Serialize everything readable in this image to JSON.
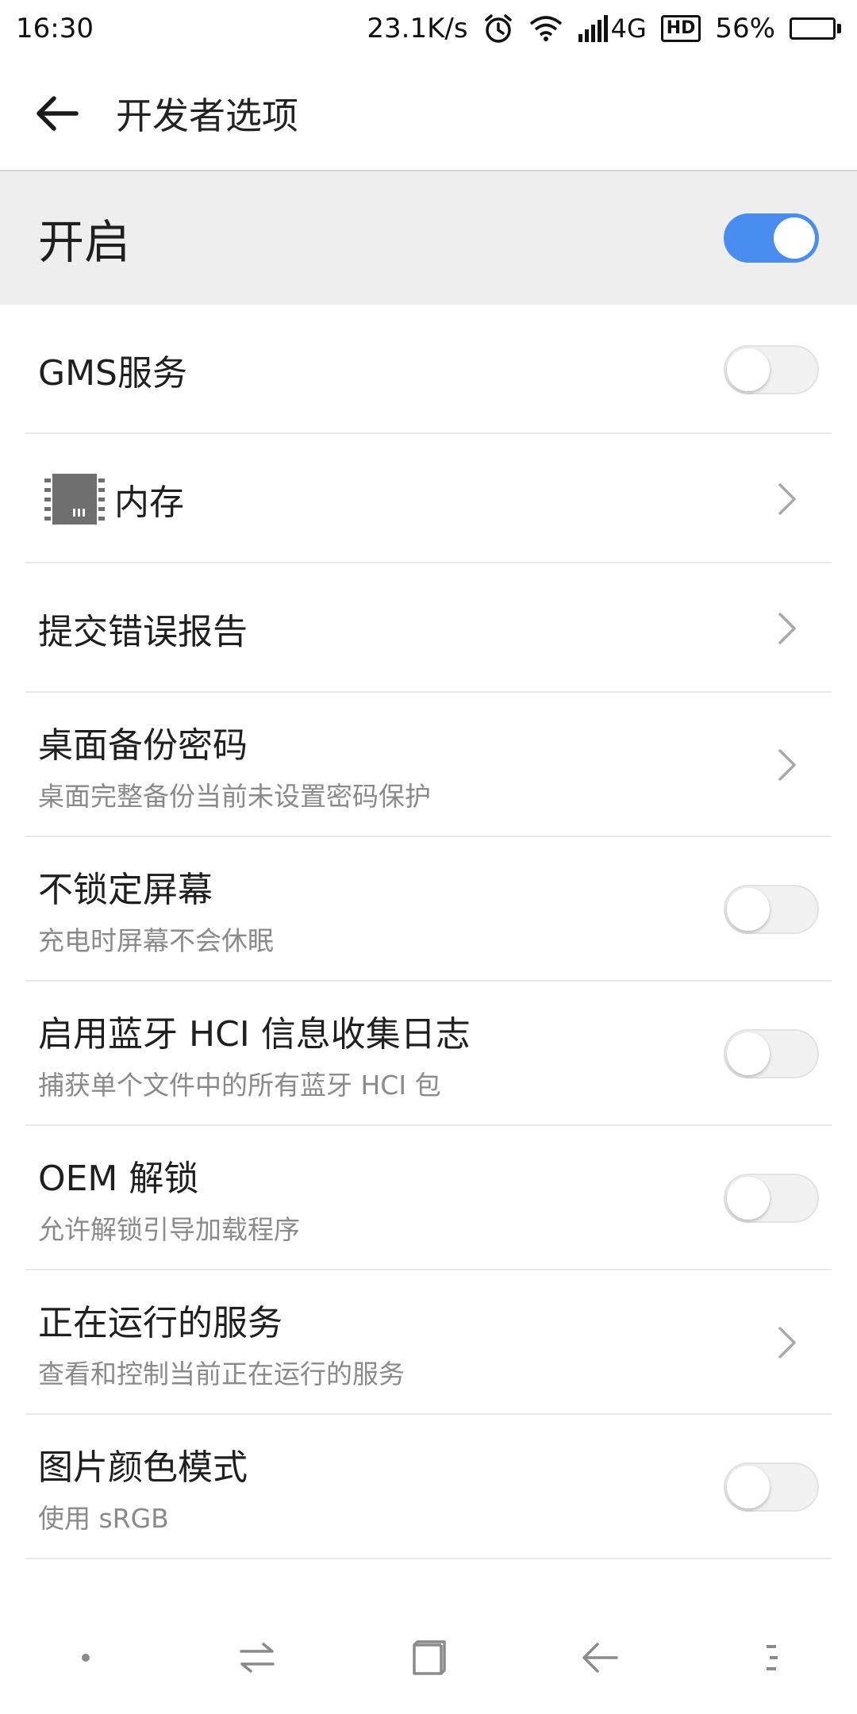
{
  "status_bar": {
    "time": "16:30",
    "speed": "23.1K/s",
    "network": "4G",
    "hd": "HD",
    "battery_percent": "56%",
    "battery_level": 0.56,
    "icons": [
      "alarm-icon",
      "wifi-icon",
      "signal-icon",
      "hd-icon",
      "battery-icon"
    ]
  },
  "header": {
    "title": "开发者选项",
    "back_icon": "back-arrow-icon"
  },
  "master_switch": {
    "label": "开启",
    "state": "on",
    "accent": "#4a8df0"
  },
  "items": [
    {
      "title": "GMS服务",
      "subtitle": "",
      "control": "switch",
      "state": "off"
    },
    {
      "title": "内存",
      "subtitle": "",
      "control": "chevron",
      "icon": "memory-chip-icon"
    },
    {
      "title": "提交错误报告",
      "subtitle": "",
      "control": "chevron"
    },
    {
      "title": "桌面备份密码",
      "subtitle": "桌面完整备份当前未设置密码保护",
      "control": "chevron"
    },
    {
      "title": "不锁定屏幕",
      "subtitle": "充电时屏幕不会休眠",
      "control": "switch",
      "state": "off"
    },
    {
      "title": "启用蓝牙 HCI 信息收集日志",
      "subtitle": "捕获单个文件中的所有蓝牙 HCI 包",
      "control": "switch",
      "state": "off"
    },
    {
      "title": "OEM 解锁",
      "subtitle": "允许解锁引导加载程序",
      "control": "switch",
      "state": "off"
    },
    {
      "title": "正在运行的服务",
      "subtitle": "查看和控制当前正在运行的服务",
      "control": "chevron"
    },
    {
      "title": "图片颜色模式",
      "subtitle": "使用 sRGB",
      "control": "switch",
      "state": "off"
    }
  ],
  "nav": {
    "buttons": [
      "menu-dot-icon",
      "switch-arrows-icon",
      "square-icon",
      "back-icon",
      "more-icon"
    ]
  }
}
